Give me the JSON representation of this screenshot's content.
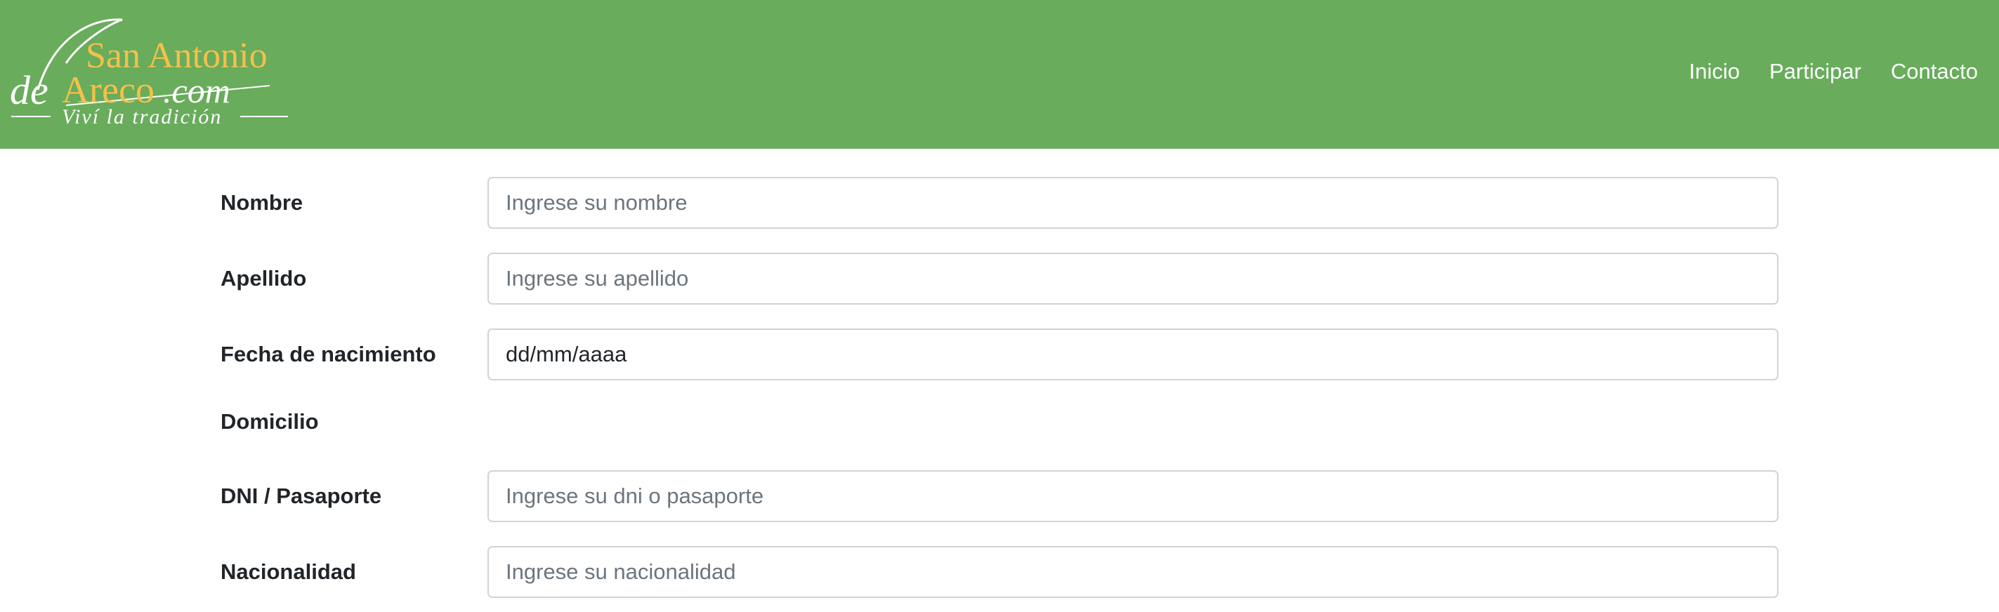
{
  "header": {
    "logo": {
      "line1": "San Antonio",
      "line2_script": "de",
      "line2": "Areco",
      "line2_suffix": ".com",
      "tagline": "Viví la tradición"
    },
    "nav": [
      {
        "label": "Inicio"
      },
      {
        "label": "Participar"
      },
      {
        "label": "Contacto"
      }
    ]
  },
  "form": {
    "nombre": {
      "label": "Nombre",
      "placeholder": "Ingrese su nombre"
    },
    "apellido": {
      "label": "Apellido",
      "placeholder": "Ingrese su apellido"
    },
    "fecha": {
      "label": "Fecha de nacimiento",
      "value": "dd/mm/aaaa"
    },
    "domicilio": {
      "label": "Domicilio"
    },
    "dni": {
      "label": "DNI / Pasaporte",
      "placeholder": "Ingrese su dni o pasaporte"
    },
    "nacionalidad": {
      "label": "Nacionalidad",
      "placeholder": "Ingrese su nacionalidad"
    }
  },
  "colors": {
    "navbar": "#68ac5c",
    "logo_accent": "#f5c04a",
    "logo_white": "#ffffff"
  }
}
